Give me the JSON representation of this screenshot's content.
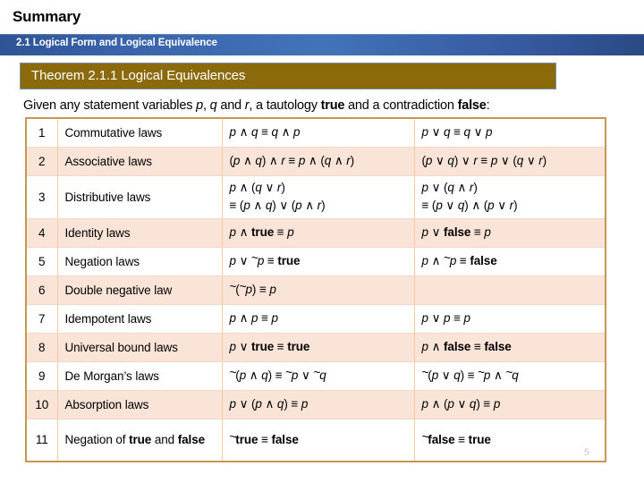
{
  "slide": {
    "title": "Summary",
    "section_bar": "2.1 Logical Form and Logical Equivalence",
    "theorem_banner": "Theorem 2.1.1 Logical Equivalences",
    "page_number": "5"
  },
  "intro": {
    "part1": "Given any statement variables ",
    "var_p": "p",
    "sep1": ", ",
    "var_q": "q",
    "part2": " and ",
    "var_r": "r",
    "part3": ", a tautology ",
    "true_word": "true",
    "part4": " and a contradiction ",
    "false_word": "false",
    "part5": ":"
  },
  "colors": {
    "section_bar": "#2f5496",
    "theorem_banner": "#8b6a0b",
    "table_border": "#c8974f",
    "row_shade": "#fae3d7",
    "row_plain": "#ffffff"
  },
  "table": {
    "rows": [
      {
        "num": "1",
        "name": "Commutative laws",
        "f1": "p ∧ q ≡ q ∧ p",
        "f2": "p ∨ q ≡ q ∨ p"
      },
      {
        "num": "2",
        "name": "Associative laws",
        "f1": "(p ∧ q) ∧ r ≡ p ∧ (q ∧ r)",
        "f2": "(p ∨ q) ∨ r ≡ p ∨ (q ∨ r)"
      },
      {
        "num": "3",
        "name": "Distributive laws",
        "f1": "p ∧ (q ∨ r)\n≡ (p ∧ q) ∨ (p ∧ r)",
        "f2": "p ∨ (q ∧ r)\n≡ (p ∨ q) ∧ (p ∨ r)"
      },
      {
        "num": "4",
        "name": "Identity laws",
        "f1": "p ∧ true ≡ p",
        "f2": "p ∨ false ≡ p"
      },
      {
        "num": "5",
        "name": "Negation laws",
        "f1": "p ∨ ~p ≡ true",
        "f2": "p ∧ ~p ≡ false"
      },
      {
        "num": "6",
        "name": "Double negative law",
        "f1": "~(~p) ≡ p",
        "f2": ""
      },
      {
        "num": "7",
        "name": "Idempotent laws",
        "f1": "p ∧ p ≡ p",
        "f2": "p ∨ p ≡ p"
      },
      {
        "num": "8",
        "name": "Universal bound laws",
        "f1": "p ∨ true ≡ true",
        "f2": "p ∧ false ≡ false"
      },
      {
        "num": "9",
        "name": "De Morgan’s laws",
        "f1": "~(p ∧ q) ≡ ~p ∨ ~q",
        "f2": "~(p ∨ q) ≡ ~p ∧ ~q"
      },
      {
        "num": "10",
        "name": "Absorption laws",
        "f1": "p ∨ (p ∧ q) ≡ p",
        "f2": "p ∧ (p ∨ q) ≡ p"
      },
      {
        "num": "11",
        "name": "Negation of true and false",
        "f1": "~true ≡ false",
        "f2": "~false ≡ true"
      }
    ]
  }
}
